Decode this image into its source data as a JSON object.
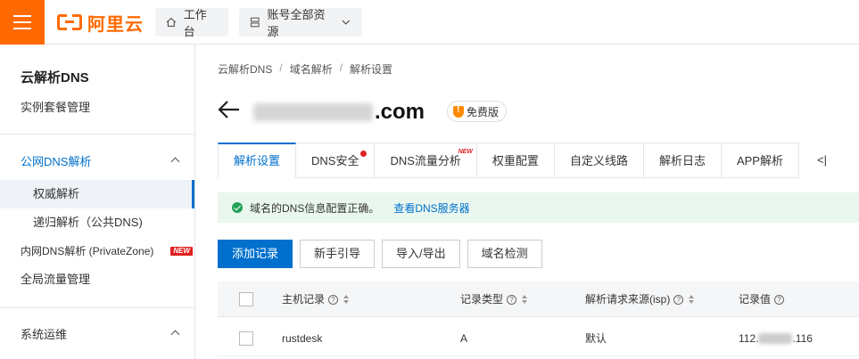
{
  "topbar": {
    "logo_text": "阿里云",
    "workbench_label": "工作台",
    "resources_label": "账号全部资源"
  },
  "sidebar": {
    "title": "云解析DNS",
    "items": [
      {
        "label": "实例套餐管理"
      },
      {
        "label": "公网DNS解析"
      },
      {
        "label": "权威解析"
      },
      {
        "label": "递归解析（公共DNS)"
      },
      {
        "label": "内网DNS解析 (PrivateZone)",
        "badge": "NEW"
      },
      {
        "label": "全局流量管理"
      },
      {
        "label": "系统运维"
      }
    ]
  },
  "breadcrumb": [
    "云解析DNS",
    "域名解析",
    "解析设置"
  ],
  "domain": {
    "suffix": ".com",
    "badge": "免费版"
  },
  "tabs": [
    {
      "label": "解析设置",
      "active": true
    },
    {
      "label": "DNS安全",
      "dot": true
    },
    {
      "label": "DNS流量分析",
      "badge": "NEW"
    },
    {
      "label": "权重配置"
    },
    {
      "label": "自定义线路"
    },
    {
      "label": "解析日志"
    },
    {
      "label": "APP解析"
    }
  ],
  "tabs_more": "<|",
  "alert": {
    "message": "域名的DNS信息配置正确。",
    "link": "查看DNS服务器"
  },
  "actions": {
    "add": "添加记录",
    "guide": "新手引导",
    "import_export": "导入/导出",
    "detect": "域名检测"
  },
  "table": {
    "headers": [
      "主机记录",
      "记录类型",
      "解析请求来源(isp)",
      "记录值"
    ],
    "rows": [
      {
        "host": "rustdesk",
        "type": "A",
        "isp": "默认",
        "value_prefix": "112.",
        "value_suffix": ".116"
      }
    ]
  },
  "colors": {
    "brand": "#ff6a00",
    "primary": "#0070cc",
    "success": "#23a35a",
    "badge_red": "#e02020"
  }
}
